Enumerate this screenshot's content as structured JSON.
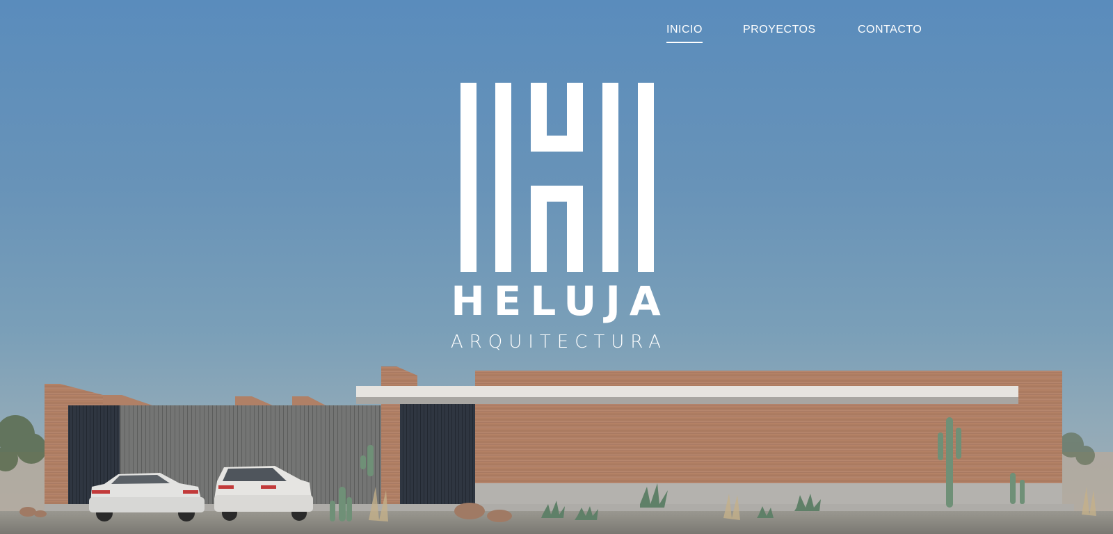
{
  "nav": {
    "items": [
      {
        "label": "INICIO",
        "active": true
      },
      {
        "label": "PROYECTOS",
        "active": false
      },
      {
        "label": "CONTACTO",
        "active": false
      }
    ]
  },
  "brand": {
    "name": "HELUJA",
    "subtitle": "ARQUITECTURA"
  },
  "colors": {
    "sky_top": "#5a8cbc",
    "text": "#ffffff",
    "brick": "#b07e64",
    "wood_fence": "#6f7070",
    "dark_panel": "#2e3540"
  }
}
